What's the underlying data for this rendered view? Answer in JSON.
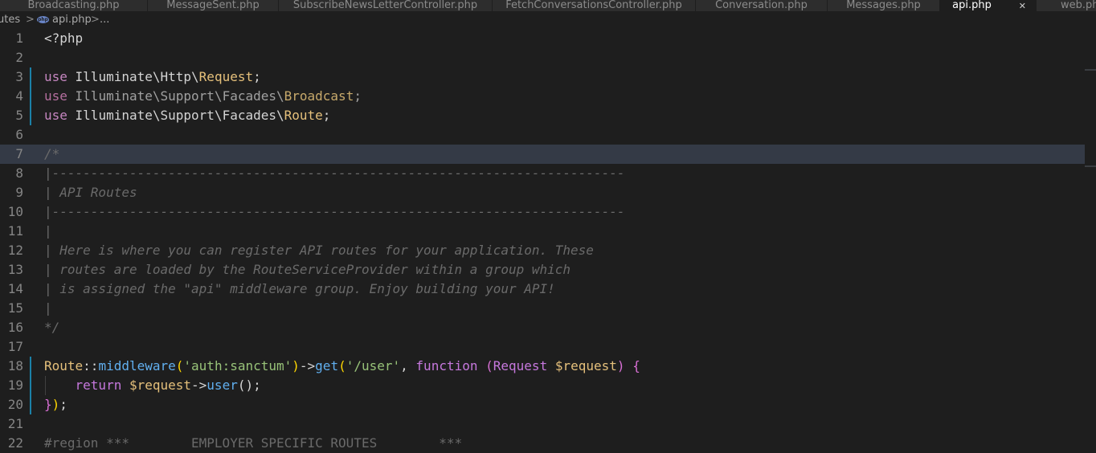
{
  "tabs": [
    {
      "label": "Broadcasting.php"
    },
    {
      "label": "MessageSent.php"
    },
    {
      "label": "SubscribeNewsLetterController.php"
    },
    {
      "label": "FetchConversationsController.php"
    },
    {
      "label": "Conversation.php"
    },
    {
      "label": "Messages.php"
    },
    {
      "label": "api.php",
      "close": "✕"
    },
    {
      "label": "web.php"
    }
  ],
  "breadcrumb": {
    "folder": "routes",
    "separator": ">",
    "file_icon": "php-file-icon",
    "file_icon_text": "php",
    "file": "api.php",
    "more": "..."
  },
  "editor": {
    "lines": [
      {
        "num": "1",
        "tokens": [
          {
            "t": "<?php",
            "c": "#d4d4d4"
          }
        ]
      },
      {
        "num": "2",
        "tokens": []
      },
      {
        "num": "3",
        "tokens": [
          {
            "t": "use",
            "c": "#c586c0"
          },
          {
            "t": " Illuminate\\Http\\",
            "c": "#d4d4d4"
          },
          {
            "t": "Request",
            "c": "#e5c07b"
          },
          {
            "t": ";",
            "c": "#d4d4d4"
          }
        ]
      },
      {
        "num": "4",
        "tokens": [
          {
            "t": "use",
            "c": "#b56f9f"
          },
          {
            "t": " Illuminate\\Support\\Facades\\",
            "c": "#a0a0a0"
          },
          {
            "t": "Broadcast",
            "c": "#c7a96b"
          },
          {
            "t": ";",
            "c": "#a0a0a0"
          }
        ]
      },
      {
        "num": "5",
        "tokens": [
          {
            "t": "use",
            "c": "#c586c0"
          },
          {
            "t": " Illuminate\\Support\\Facades\\",
            "c": "#d4d4d4"
          },
          {
            "t": "Route",
            "c": "#e5c07b"
          },
          {
            "t": ";",
            "c": "#d4d4d4"
          }
        ]
      },
      {
        "num": "6",
        "tokens": []
      },
      {
        "num": "7",
        "tokens": [
          {
            "t": "/*",
            "c": "#6a6a6a",
            "i": true
          }
        ]
      },
      {
        "num": "8",
        "tokens": [
          {
            "t": "|--------------------------------------------------------------------------",
            "c": "#6a6a6a",
            "i": true
          }
        ]
      },
      {
        "num": "9",
        "tokens": [
          {
            "t": "| API Routes",
            "c": "#6a6a6a",
            "i": true
          }
        ]
      },
      {
        "num": "10",
        "tokens": [
          {
            "t": "|--------------------------------------------------------------------------",
            "c": "#6a6a6a",
            "i": true
          }
        ]
      },
      {
        "num": "11",
        "tokens": [
          {
            "t": "|",
            "c": "#6a6a6a",
            "i": true
          }
        ]
      },
      {
        "num": "12",
        "tokens": [
          {
            "t": "| Here is where you can register API routes for your application. These",
            "c": "#6a6a6a",
            "i": true
          }
        ]
      },
      {
        "num": "13",
        "tokens": [
          {
            "t": "| routes are loaded by the RouteServiceProvider within a group which",
            "c": "#6a6a6a",
            "i": true
          }
        ]
      },
      {
        "num": "14",
        "tokens": [
          {
            "t": "| is assigned the \"api\" middleware group. Enjoy building your API!",
            "c": "#6a6a6a",
            "i": true
          }
        ]
      },
      {
        "num": "15",
        "tokens": [
          {
            "t": "|",
            "c": "#6a6a6a",
            "i": true
          }
        ]
      },
      {
        "num": "16",
        "tokens": [
          {
            "t": "*/",
            "c": "#6a6a6a",
            "i": true
          }
        ]
      },
      {
        "num": "17",
        "tokens": []
      },
      {
        "num": "18",
        "tokens": [
          {
            "t": "Route",
            "c": "#e5c07b"
          },
          {
            "t": "::",
            "c": "#d4d4d4"
          },
          {
            "t": "middleware",
            "c": "#61afef"
          },
          {
            "t": "(",
            "c": "#ffd700"
          },
          {
            "t": "'auth:sanctum'",
            "c": "#98c379"
          },
          {
            "t": ")",
            "c": "#ffd700"
          },
          {
            "t": "->",
            "c": "#d4d4d4"
          },
          {
            "t": "get",
            "c": "#61afef"
          },
          {
            "t": "(",
            "c": "#ffd700"
          },
          {
            "t": "'/user'",
            "c": "#98c379"
          },
          {
            "t": ", ",
            "c": "#d4d4d4"
          },
          {
            "t": "function",
            "c": "#c678dd"
          },
          {
            "t": " ",
            "c": "#d4d4d4"
          },
          {
            "t": "(",
            "c": "#da70d6"
          },
          {
            "t": "Request",
            "c": "#c678dd"
          },
          {
            "t": " ",
            "c": "#d4d4d4"
          },
          {
            "t": "$request",
            "c": "#e5c07b"
          },
          {
            "t": ")",
            "c": "#da70d6"
          },
          {
            "t": " ",
            "c": "#d4d4d4"
          },
          {
            "t": "{",
            "c": "#da70d6"
          }
        ]
      },
      {
        "num": "19",
        "tokens": [
          {
            "t": "    ",
            "c": "#d4d4d4"
          },
          {
            "t": "return",
            "c": "#c678dd"
          },
          {
            "t": " ",
            "c": "#d4d4d4"
          },
          {
            "t": "$request",
            "c": "#e5c07b"
          },
          {
            "t": "->",
            "c": "#d4d4d4"
          },
          {
            "t": "user",
            "c": "#61afef"
          },
          {
            "t": "();",
            "c": "#d4d4d4"
          }
        ]
      },
      {
        "num": "20",
        "tokens": [
          {
            "t": "}",
            "c": "#da70d6"
          },
          {
            "t": ")",
            "c": "#ffd700"
          },
          {
            "t": ";",
            "c": "#d4d4d4"
          }
        ]
      },
      {
        "num": "21",
        "tokens": []
      },
      {
        "num": "22",
        "tokens": [
          {
            "t": "#region ***        EMPLOYER SPECIFIC ROUTES        ***",
            "c": "#6a6a6a"
          }
        ]
      }
    ]
  }
}
